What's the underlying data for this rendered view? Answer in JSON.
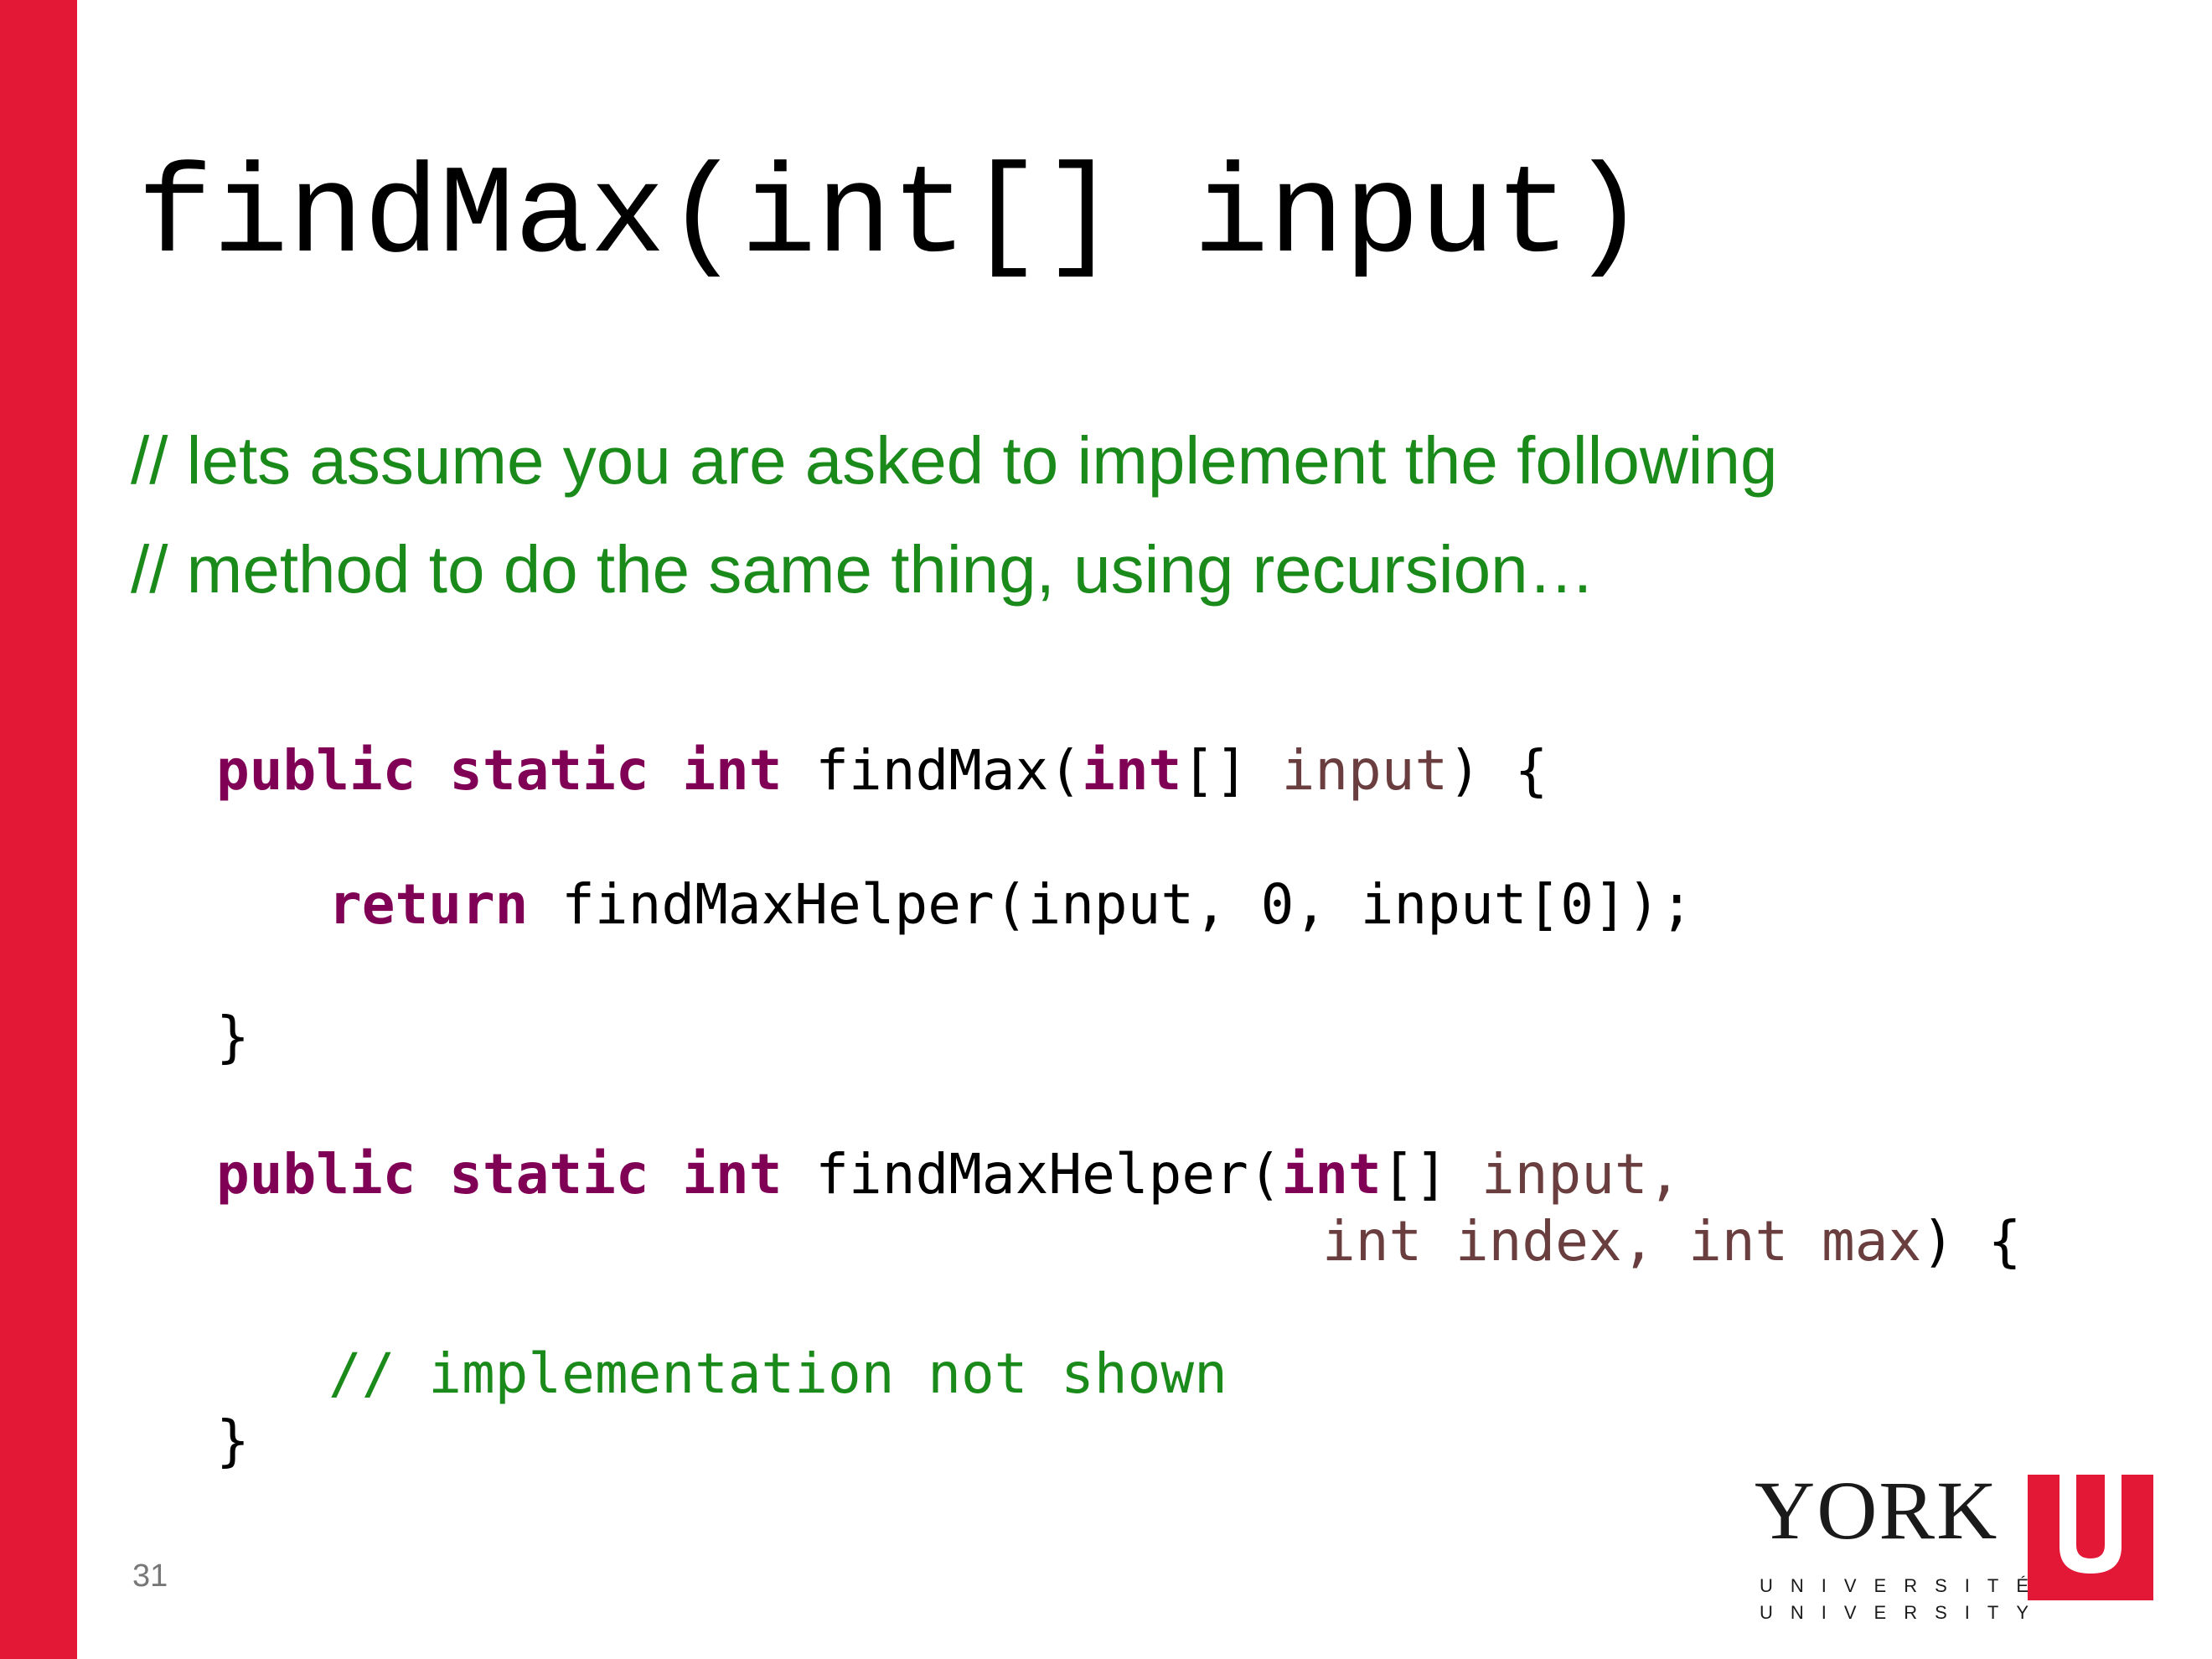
{
  "slide": {
    "title": "findMax(int[] input)",
    "comments": [
      "// lets assume you are asked to implement the following",
      "// method to do the same thing, using recursion…"
    ],
    "code": {
      "line1": {
        "kw": "public static int",
        "name": " findMax(",
        "type": "int",
        "brackets": "[] ",
        "param": "input",
        "end": ") {"
      },
      "line2": {
        "kw": "return",
        "rest": " findMaxHelper(input, 0, input[0]);"
      },
      "line3": "}",
      "line4": {
        "kw": "public static int",
        "name": " findMaxHelper(",
        "type": "int",
        "brackets": "[] ",
        "param": "input,"
      },
      "line5": {
        "params": "int index, int max",
        "end": ") {"
      },
      "line6": "// implementation not shown",
      "line7": "}"
    },
    "page_number": "31"
  },
  "logo": {
    "name": "YORK",
    "line1": "UNIVERSITÉ",
    "line2": "UNIVERSITY",
    "letter": "U",
    "colors": {
      "brand_red": "#e31837"
    }
  }
}
